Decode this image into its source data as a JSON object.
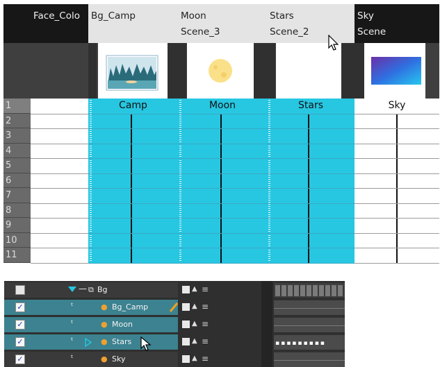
{
  "xsheet": {
    "columns": [
      {
        "name": "Face_Colo",
        "scene": "",
        "cell_label": ""
      },
      {
        "name": "Bg_Camp",
        "scene": "",
        "cell_label": "Camp"
      },
      {
        "name": "Moon",
        "scene": "Scene_3",
        "cell_label": "Moon"
      },
      {
        "name": "Stars",
        "scene": "Scene_2",
        "cell_label": "Stars"
      },
      {
        "name": "Sky",
        "scene": "Scene",
        "cell_label": "Sky"
      }
    ],
    "frames": [
      "1",
      "2",
      "3",
      "4",
      "5",
      "6",
      "7",
      "8",
      "9",
      "10",
      "11"
    ]
  },
  "timeline": {
    "layers": [
      {
        "name": "Bg",
        "checked": false,
        "type": "group"
      },
      {
        "name": "Bg_Camp",
        "checked": true,
        "type": "drawing"
      },
      {
        "name": "Moon",
        "checked": true,
        "type": "drawing"
      },
      {
        "name": "Stars",
        "checked": true,
        "type": "drawing"
      },
      {
        "name": "Sky",
        "checked": true,
        "type": "drawing"
      }
    ],
    "check_glyph": "✓",
    "lock_glyph": "🔒",
    "stars_dots": "▪▪▪▪▪▪▪▪▪"
  },
  "colors": {
    "cell_cyan": "#27c7e2",
    "header_dark": "#171717",
    "header_light": "#e4e4e4",
    "active_layer": "#3c8290"
  },
  "icons": {
    "cursor": "arrow-cursor-icon",
    "pencil": "pencil-icon",
    "drawing_layer": "drawing-layer-icon",
    "group_layer": "group-layer-icon"
  }
}
